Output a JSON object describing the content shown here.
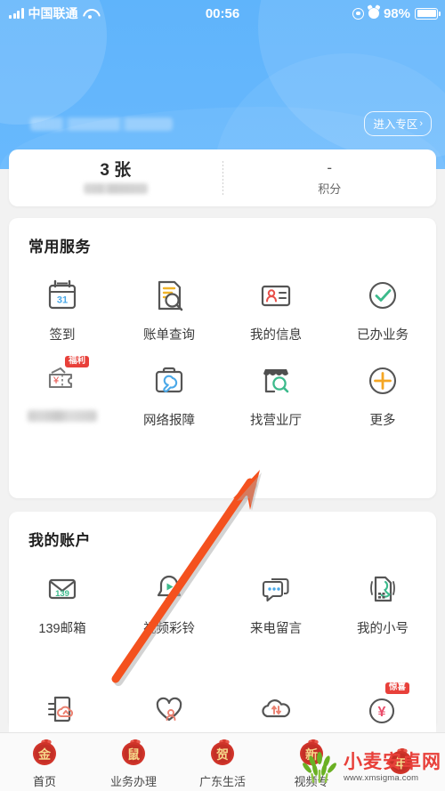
{
  "status_bar": {
    "carrier": "中国联通",
    "time": "00:56",
    "battery_percent": "98%",
    "signal_icon": "signal-bars-icon",
    "wifi_icon": "wifi-icon",
    "eye_icon": "eye-icon",
    "alarm_icon": "alarm-clock-icon",
    "battery_icon": "battery-icon"
  },
  "header": {
    "promo_banner_text": "",
    "enter_zone_label": "进入专区",
    "enter_zone_chevron": "›"
  },
  "stats": [
    {
      "value": "3 张",
      "label": "",
      "label_blurred": true
    },
    {
      "value": "-",
      "label": "积分",
      "label_blurred": false
    }
  ],
  "services": {
    "title": "常用服务",
    "items": [
      {
        "label": "签到",
        "icon": "calendar-icon",
        "badge": "",
        "blurred": false
      },
      {
        "label": "账单查询",
        "icon": "bill-search-icon",
        "badge": "",
        "blurred": false
      },
      {
        "label": "我的信息",
        "icon": "id-card-icon",
        "badge": "",
        "blurred": false
      },
      {
        "label": "已办业务",
        "icon": "check-circle-icon",
        "badge": "",
        "blurred": false
      },
      {
        "label": "",
        "icon": "coupon-icon",
        "badge": "福利",
        "blurred": true
      },
      {
        "label": "网络报障",
        "icon": "toolbox-wrench-icon",
        "badge": "",
        "blurred": false
      },
      {
        "label": "找营业厅",
        "icon": "shop-search-icon",
        "badge": "",
        "blurred": false
      },
      {
        "label": "更多",
        "icon": "plus-circle-icon",
        "badge": "",
        "blurred": false
      }
    ]
  },
  "accounts": {
    "title": "我的账户",
    "items": [
      {
        "label": "139邮箱",
        "icon": "mail-139-icon",
        "badge": ""
      },
      {
        "label": "视频彩铃",
        "icon": "video-ringtone-icon",
        "badge": ""
      },
      {
        "label": "来电留言",
        "icon": "voice-message-icon",
        "badge": ""
      },
      {
        "label": "我的小号",
        "icon": "sim-phone-icon",
        "badge": ""
      }
    ],
    "partial_items": [
      {
        "label": "",
        "icon": "cloud-upload-doc-icon",
        "badge": ""
      },
      {
        "label": "",
        "icon": "heart-contacts-icon",
        "badge": ""
      },
      {
        "label": "",
        "icon": "cloud-transfer-icon",
        "badge": ""
      },
      {
        "label": "",
        "icon": "yuan-circle-icon",
        "badge": "惊喜"
      }
    ]
  },
  "tabbar": [
    {
      "label": "首页",
      "glyph": "金",
      "active": true
    },
    {
      "label": "业务办理",
      "glyph": "鼠",
      "active": false
    },
    {
      "label": "广东生活",
      "glyph": "贺",
      "active": false
    },
    {
      "label": "视频专",
      "glyph": "新",
      "active": false
    },
    {
      "label": "",
      "glyph": "年",
      "active": false
    }
  ],
  "watermark": {
    "site_name": "小麦安卓网",
    "url": "www.xmsigma.com",
    "logo_icon": "wheat-logo-icon"
  },
  "annotation": {
    "arrow_icon": "pointer-arrow-icon",
    "points_to": "找营业厅"
  },
  "colors": {
    "header_blue": "#64b6fc",
    "badge_red": "#e8403a",
    "accent_green": "#3cba8c",
    "accent_orange": "#f5a623",
    "accent_blue": "#4aa8e8",
    "arrow_orange": "#f4511e",
    "watermark_red": "#e8403a",
    "watermark_green": "#6ab023"
  }
}
